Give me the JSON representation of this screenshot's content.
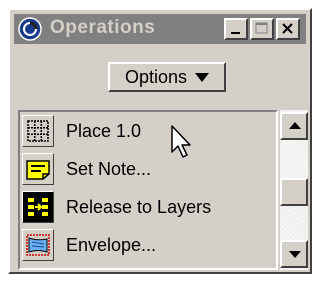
{
  "window": {
    "title": "Operations",
    "options_label": "Options"
  },
  "tools": [
    {
      "label": "Place 1.0",
      "icon": "dotted-grid-icon"
    },
    {
      "label": "Set Note...",
      "icon": "note-icon"
    },
    {
      "label": "Release to Layers",
      "icon": "layers-icon"
    },
    {
      "label": "Envelope...",
      "icon": "envelope-icon"
    }
  ],
  "colors": {
    "face": "#d4d0c8",
    "titlebar_inactive": "#808080",
    "note_yellow": "#ffff00",
    "envelope_blue": "#6ab0f0",
    "envelope_red": "#cc0000"
  }
}
